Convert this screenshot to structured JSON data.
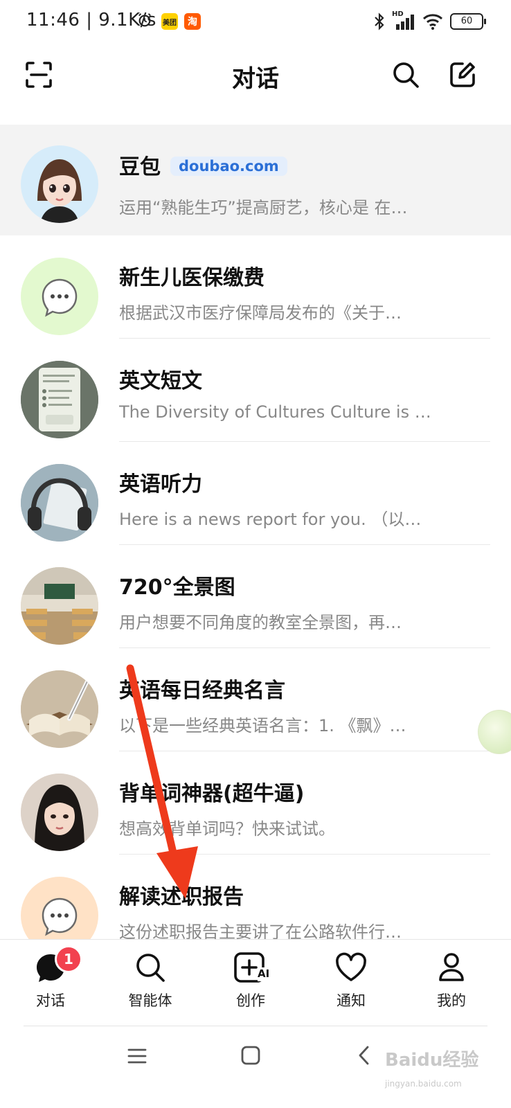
{
  "status_bar": {
    "time": "11:46",
    "speed": "| 9.1K/s",
    "app1": "美团",
    "app2": "淘",
    "signal_label": "HD",
    "battery": "60"
  },
  "header": {
    "title": "对话"
  },
  "conversations": [
    {
      "name": "豆包",
      "domain": "doubao.com",
      "preview": "运用“熟能生巧”提高厨艺，核心是 在…"
    },
    {
      "name": "新生儿医保缴费",
      "preview": "根据武汉市医疗保障局发布的《关于…"
    },
    {
      "name": "英文短文",
      "preview": "The Diversity of Cultures Culture is …"
    },
    {
      "name": "英语听力",
      "preview": "Here is a news report for you. （以…"
    },
    {
      "name": "720°全景图",
      "preview": "用户想要不同角度的教室全景图，再…"
    },
    {
      "name": "英语每日经典名言",
      "preview": "以下是一些经典英语名言：1. 《飘》…"
    },
    {
      "name": "背单词神器(超牛逼)",
      "preview": "想高效背单词吗？快来试试。"
    },
    {
      "name": "解读述职报告",
      "preview": "这份述职报告主要讲了在公路软件行…"
    }
  ],
  "tabs": [
    {
      "label": "对话",
      "badge": "1"
    },
    {
      "label": "智能体"
    },
    {
      "label": "创作",
      "icon_text": "AI"
    },
    {
      "label": "通知"
    },
    {
      "label": "我的"
    }
  ],
  "watermark": {
    "text": "Baidu经验",
    "sub": "jingyan.baidu.com"
  },
  "colors": {
    "accent": "#2b6fd6",
    "badge": "#f2414f",
    "arrow": "#ee3a1c"
  }
}
